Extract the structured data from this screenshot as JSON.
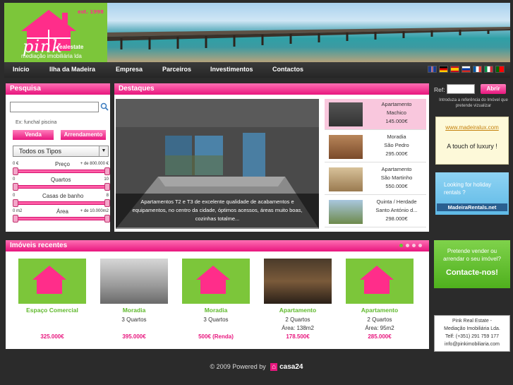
{
  "logo": {
    "est": "est. 1998",
    "brand": "pink",
    "brand_suffix": "realestate",
    "subtitle": "mediação imobiliária lda"
  },
  "nav": {
    "items": [
      "Início",
      "Ilha da Madeira",
      "Empresa",
      "Parceiros",
      "Investimentos",
      "Contactos"
    ]
  },
  "languages": [
    {
      "name": "english-flag",
      "colors": [
        "#1d3b8f",
        "#ffffff",
        "#d22b2b"
      ]
    },
    {
      "name": "german-flag",
      "colors": [
        "#000000",
        "#dd0000",
        "#ffce00"
      ]
    },
    {
      "name": "spanish-flag",
      "colors": [
        "#c60b1e",
        "#ffc400",
        "#c60b1e"
      ]
    },
    {
      "name": "russian-flag",
      "colors": [
        "#ffffff",
        "#0039a6",
        "#d52b1e"
      ]
    },
    {
      "name": "french-flag",
      "colors": [
        "#0055a4",
        "#ffffff",
        "#ef4135"
      ]
    },
    {
      "name": "italian-flag",
      "colors": [
        "#009246",
        "#ffffff",
        "#ce2b37"
      ]
    },
    {
      "name": "portuguese-flag",
      "colors": [
        "#006600",
        "#ff0000",
        "#ff0000"
      ]
    }
  ],
  "search": {
    "title": "Pesquisa",
    "input_value": "",
    "hint": "Ex: funchal piscina",
    "sale_label": "Venda",
    "rent_label": "Arrendamento",
    "type_select": "Todos os Tipos",
    "price": {
      "label": "Preço",
      "min": "0 €",
      "max": "+ de 800.000 €"
    },
    "rooms": {
      "label": "Quartos",
      "min": "0",
      "max": "10"
    },
    "baths": {
      "label": "Casas de banho",
      "min": "0",
      "max": "8"
    },
    "area": {
      "label": "Área",
      "min": "0 m2",
      "max": "+ de 10.000m2"
    }
  },
  "highlights": {
    "title": "Destaques",
    "caption": "Apartamentos T2 e T3 de excelente qualidade de acabamentos e equipamentos, no centro da cidade, óptimos acessos, áreas muito boas, cozinhas totalme...",
    "items": [
      {
        "type": "Apartamento",
        "place": "Machico",
        "price": "145.000€"
      },
      {
        "type": "Moradia",
        "place": "São Pedro",
        "price": "295.000€"
      },
      {
        "type": "Apartamento",
        "place": "São Martinho",
        "price": "550.000€"
      },
      {
        "type": "Quinta / Herdade",
        "place": "Santo António d...",
        "price": "298.000€"
      }
    ]
  },
  "reference": {
    "label": "Ref:",
    "button": "Abrir",
    "hint": "Introduza a referência do Imóvel que pretende vizualizar"
  },
  "ads": {
    "madeiralux_url": "www.madeiralux.com",
    "madeiralux_tag": "A touch of luxury !",
    "rentals_text": "Looking for holiday rentals ?",
    "rentals_url": "MadeiraRentals.net"
  },
  "sell": {
    "text": "Pretende vender ou arrendar o seu imóvel?",
    "cta": "Contacte-nos!"
  },
  "contact": {
    "lines": [
      "Pink Real Estate -",
      "Mediação Imobiliária Lda.",
      "Telf: (+351) 291 759 177",
      "info@pinkimobiliaria.com"
    ]
  },
  "recent": {
    "title": "Imóveis recentes",
    "cards": [
      {
        "type": "Espaço Comercial",
        "line1": "",
        "line2": "",
        "price": "325.000€"
      },
      {
        "type": "Moradia",
        "line1": "3 Quartos",
        "line2": "",
        "price": "395.000€"
      },
      {
        "type": "Moradia",
        "line1": "3 Quartos",
        "line2": "",
        "price": "500€ (Renda)"
      },
      {
        "type": "Apartamento",
        "line1": "2 Quartos",
        "line2": "Área: 138m2",
        "price": "178.500€"
      },
      {
        "type": "Apartamento",
        "line1": "2 Quartos",
        "line2": "Área: 95m2",
        "price": "285.000€"
      }
    ]
  },
  "footer": {
    "text": "© 2009 Powered by",
    "brand": "casa24"
  }
}
